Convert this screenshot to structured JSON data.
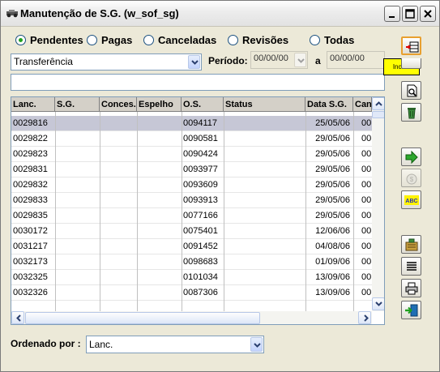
{
  "window": {
    "title": "Manutenção de S.G. (w_sof_sg)"
  },
  "filters": {
    "status_options": [
      {
        "label": "Pendentes",
        "selected": true
      },
      {
        "label": "Pagas",
        "selected": false
      },
      {
        "label": "Canceladas",
        "selected": false
      },
      {
        "label": "Revisões",
        "selected": false
      },
      {
        "label": "Todas",
        "selected": false
      }
    ],
    "type_combo_value": "Transferência",
    "period_label": "Período:",
    "period_from": "00/00/00",
    "period_to_label": "a",
    "period_to": "00/00/00"
  },
  "tooltip": "Incluir",
  "grid": {
    "columns": [
      "Lanc.",
      "S.G.",
      "Conces.",
      "Espelho",
      "O.S.",
      "Status",
      "Data S.G.",
      "Can"
    ],
    "rows": [
      {
        "lanc": "0029816",
        "sg": "",
        "conces": "",
        "espelho": "",
        "os": "0094117",
        "status": "",
        "data": "25/05/06",
        "can": "00",
        "selected": true
      },
      {
        "lanc": "0029822",
        "sg": "",
        "conces": "",
        "espelho": "",
        "os": "0090581",
        "status": "",
        "data": "29/05/06",
        "can": "00",
        "selected": false
      },
      {
        "lanc": "0029823",
        "sg": "",
        "conces": "",
        "espelho": "",
        "os": "0090424",
        "status": "",
        "data": "29/05/06",
        "can": "00",
        "selected": false
      },
      {
        "lanc": "0029831",
        "sg": "",
        "conces": "",
        "espelho": "",
        "os": "0093977",
        "status": "",
        "data": "29/05/06",
        "can": "00",
        "selected": false
      },
      {
        "lanc": "0029832",
        "sg": "",
        "conces": "",
        "espelho": "",
        "os": "0093609",
        "status": "",
        "data": "29/05/06",
        "can": "00",
        "selected": false
      },
      {
        "lanc": "0029833",
        "sg": "",
        "conces": "",
        "espelho": "",
        "os": "0093913",
        "status": "",
        "data": "29/05/06",
        "can": "00",
        "selected": false
      },
      {
        "lanc": "0029835",
        "sg": "",
        "conces": "",
        "espelho": "",
        "os": "0077166",
        "status": "",
        "data": "29/05/06",
        "can": "00",
        "selected": false
      },
      {
        "lanc": "0030172",
        "sg": "",
        "conces": "",
        "espelho": "",
        "os": "0075401",
        "status": "",
        "data": "12/06/06",
        "can": "00",
        "selected": false
      },
      {
        "lanc": "0031217",
        "sg": "",
        "conces": "",
        "espelho": "",
        "os": "0091452",
        "status": "",
        "data": "04/08/06",
        "can": "00",
        "selected": false
      },
      {
        "lanc": "0032173",
        "sg": "",
        "conces": "",
        "espelho": "",
        "os": "0098683",
        "status": "",
        "data": "01/09/06",
        "can": "00",
        "selected": false
      },
      {
        "lanc": "0032325",
        "sg": "",
        "conces": "",
        "espelho": "",
        "os": "0101034",
        "status": "",
        "data": "13/09/06",
        "can": "00",
        "selected": false
      },
      {
        "lanc": "0032326",
        "sg": "",
        "conces": "",
        "espelho": "",
        "os": "0087306",
        "status": "",
        "data": "13/09/06",
        "can": "00",
        "selected": false
      }
    ]
  },
  "order": {
    "label": "Ordenado por :",
    "value": "Lanc."
  },
  "toolbar": [
    {
      "name": "incluir-button",
      "icon": "add-row-icon",
      "state": "active"
    },
    {
      "name": "hidden-button",
      "icon": "blank-icon",
      "state": "normal"
    },
    {
      "name": "preview-button",
      "icon": "print-preview-icon",
      "state": "normal"
    },
    {
      "name": "delete-button",
      "icon": "trash-icon",
      "state": "normal"
    },
    {
      "name": "go-button",
      "icon": "green-arrow-icon",
      "state": "normal"
    },
    {
      "name": "money-button",
      "icon": "money-bag-icon",
      "state": "disabled"
    },
    {
      "name": "spell-button",
      "icon": "abc-icon",
      "state": "normal"
    },
    {
      "name": "export-button",
      "icon": "report-icon",
      "state": "normal"
    },
    {
      "name": "align-button",
      "icon": "lines-icon",
      "state": "normal"
    },
    {
      "name": "print-button",
      "icon": "printer-icon",
      "state": "normal"
    },
    {
      "name": "exit-button",
      "icon": "exit-door-icon",
      "state": "normal"
    }
  ],
  "colors": {
    "window_bg": "#ECE9D8",
    "selected_row": "#C6C7D6",
    "tooltip_bg": "#FFFF00",
    "radio_dot": "#21A121"
  }
}
